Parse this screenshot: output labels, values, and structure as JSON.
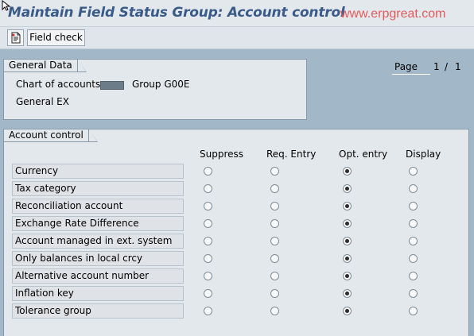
{
  "header": {
    "title": "Maintain Field Status Group: Account control",
    "watermark": "www.erpgreat.com"
  },
  "toolbar": {
    "icon": "display-document-icon",
    "field_check_label": "Field check"
  },
  "general_data": {
    "title": "General Data",
    "chart_of_accounts_label": "Chart of accounts",
    "group_label": "Group G00E",
    "group_description": "General EX"
  },
  "page": {
    "label": "Page",
    "current": "1",
    "separator": "/",
    "total": "1"
  },
  "account_control": {
    "title": "Account control",
    "columns": [
      "Suppress",
      "Req. Entry",
      "Opt. entry",
      "Display"
    ],
    "rows": [
      {
        "label": "Currency",
        "selected": "Opt. entry"
      },
      {
        "label": "Tax category",
        "selected": "Opt. entry"
      },
      {
        "label": "Reconciliation account",
        "selected": "Opt. entry"
      },
      {
        "label": "Exchange Rate Difference",
        "selected": "Opt. entry"
      },
      {
        "label": "Account managed in ext. system",
        "selected": "Opt. entry"
      },
      {
        "label": "Only balances in local crcy",
        "selected": "Opt. entry"
      },
      {
        "label": "Alternative account number",
        "selected": "Opt. entry"
      },
      {
        "label": "Inflation key",
        "selected": "Opt. entry"
      },
      {
        "label": "Tolerance group",
        "selected": "Opt. entry"
      }
    ]
  },
  "colors": {
    "background": "#a2b7c8",
    "panel": "#e3e8ed",
    "title": "#3a5a87",
    "watermark": "#e25b5b"
  }
}
